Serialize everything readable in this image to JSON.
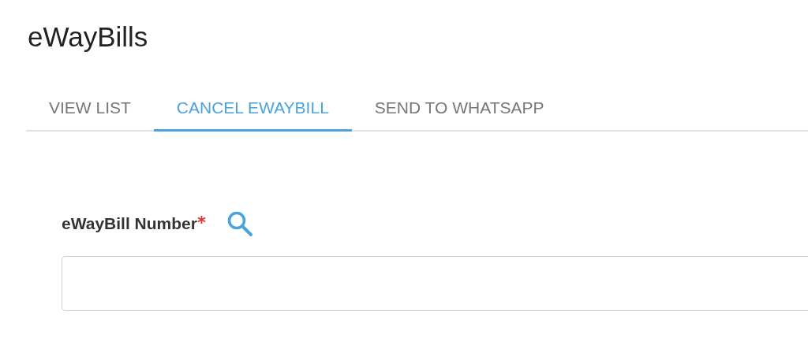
{
  "page": {
    "title": "eWayBills"
  },
  "tabs": [
    {
      "label": "VIEW LIST",
      "selected": false
    },
    {
      "label": "CANCEL EWAYBILL",
      "selected": true
    },
    {
      "label": "SEND TO WHATSAPP",
      "selected": false
    }
  ],
  "field": {
    "label": "eWayBill Number",
    "required_mark": "*"
  }
}
